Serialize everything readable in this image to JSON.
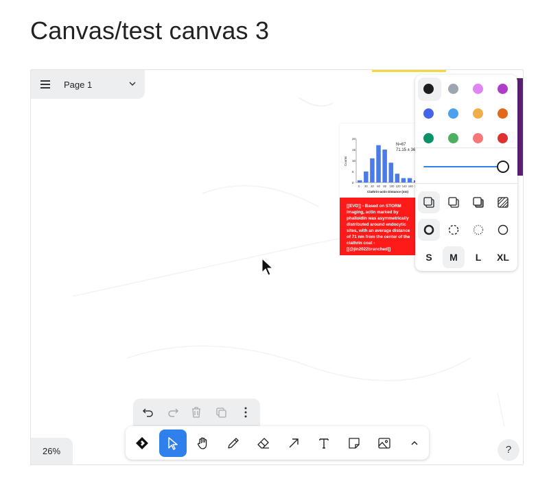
{
  "page": {
    "title": "Canvas/test canvas 3"
  },
  "page_menu": {
    "label": "Page 1"
  },
  "evidence_card": {
    "chart": {
      "n_label": "N=67",
      "mean_label": "71.15 ± 36",
      "ylabel": "Counts",
      "xlabel": "Clathrin-actin Distance (nm)",
      "y_ticks": [
        "20",
        "15",
        "10",
        "5",
        "0"
      ],
      "x_ticks": [
        "0",
        "20",
        "40",
        "60",
        "80",
        "100",
        "120",
        "140",
        "160",
        "18"
      ],
      "values": [
        1,
        5,
        11,
        17,
        15,
        9,
        4,
        2,
        2,
        1
      ],
      "ylim": [
        0,
        20
      ]
    },
    "text": "[[EVD]] - Based on STORM imaging, actin marked by phalloidin was asymmetrically distributed around endocytic sites, with an average distance of 71 nm from the center of the clathrin coat - [[@jin2022branched]]"
  },
  "style_panel": {
    "colors": [
      {
        "name": "black",
        "hex": "#1d1d1d"
      },
      {
        "name": "grey",
        "hex": "#9ea6b0"
      },
      {
        "name": "light-violet",
        "hex": "#e085f4"
      },
      {
        "name": "violet",
        "hex": "#ae3ec9"
      },
      {
        "name": "blue",
        "hex": "#4465e9"
      },
      {
        "name": "light-blue",
        "hex": "#4ba1f1"
      },
      {
        "name": "yellow",
        "hex": "#f1ac4b"
      },
      {
        "name": "orange",
        "hex": "#e16919"
      },
      {
        "name": "green",
        "hex": "#099268"
      },
      {
        "name": "light-green",
        "hex": "#4cb05e"
      },
      {
        "name": "light-red",
        "hex": "#f87777"
      },
      {
        "name": "red",
        "hex": "#e03131"
      }
    ],
    "opacity": 1.0,
    "sizes": [
      "S",
      "M",
      "L",
      "XL"
    ],
    "selected_size": "M"
  },
  "action_bar": {
    "items": [
      "undo-icon",
      "redo-icon",
      "trash-icon",
      "duplicate-icon",
      "more-icon"
    ]
  },
  "toolbar": {
    "tools": [
      "logo-icon",
      "select-icon",
      "hand-icon",
      "draw-icon",
      "eraser-icon",
      "arrow-icon",
      "text-icon",
      "note-icon",
      "image-icon",
      "chevron-up-icon"
    ],
    "active": "select-icon"
  },
  "zoom": {
    "label": "26%"
  },
  "help": {
    "label": "?"
  },
  "accent_color": "#2f80ed"
}
